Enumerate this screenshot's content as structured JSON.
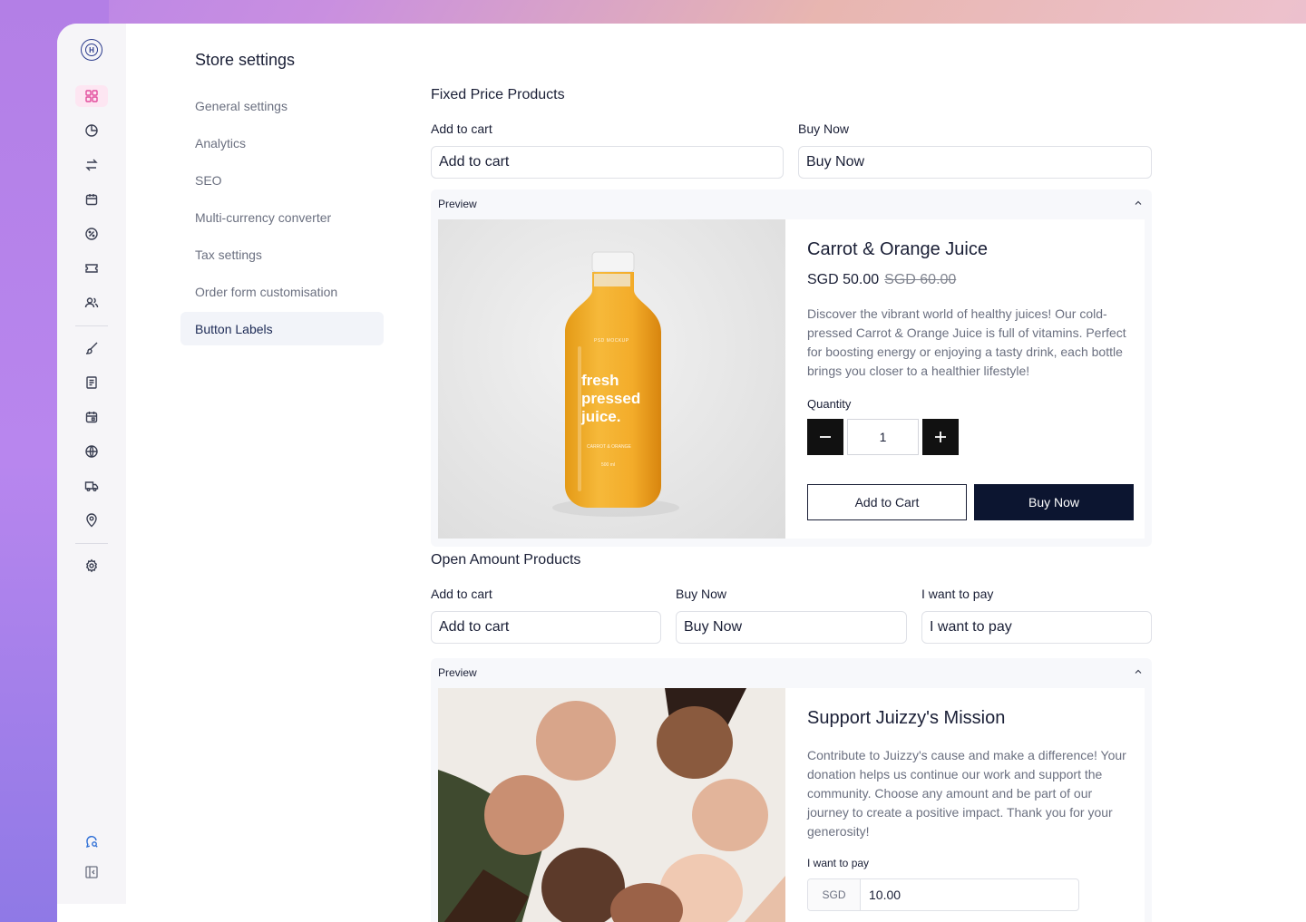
{
  "sidebar": {
    "logo_letter": "H",
    "icons": [
      "grid-icon",
      "clock-icon",
      "arrows-icon",
      "calendar-box-icon",
      "percent-icon",
      "ticket-icon",
      "users-icon",
      "brush-icon",
      "document-icon",
      "calendar-icon",
      "globe-icon",
      "truck-icon",
      "location-icon",
      "gear-icon",
      "support-icon",
      "collapse-icon"
    ]
  },
  "settings": {
    "title": "Store settings",
    "items": [
      {
        "label": "General settings"
      },
      {
        "label": "Analytics"
      },
      {
        "label": "SEO"
      },
      {
        "label": "Multi-currency converter"
      },
      {
        "label": "Tax settings"
      },
      {
        "label": "Order form customisation"
      },
      {
        "label": "Button Labels",
        "active": true
      }
    ]
  },
  "fixed": {
    "title": "Fixed Price Products",
    "add_label": "Add to cart",
    "add_value": "Add to cart",
    "buy_label": "Buy Now",
    "buy_value": "Buy Now",
    "preview_label": "Preview",
    "product": {
      "name": "Carrot & Orange Juice",
      "price": "SGD 50.00",
      "old_price": "SGD 60.00",
      "description": "Discover the vibrant world of healthy juices! Our cold-pressed Carrot & Orange Juice is full of vitamins. Perfect for boosting energy or enjoying a tasty drink, each bottle brings you closer to a healthier lifestyle!",
      "quantity_label": "Quantity",
      "quantity": "1",
      "add_button": "Add to Cart",
      "buy_button": "Buy Now",
      "bottle_small": "PSD MOCKUP",
      "bottle_big": [
        "fresh",
        "pressed",
        "juice."
      ],
      "bottle_flavor": "CARROT & ORANGE",
      "bottle_size": "500 ml"
    }
  },
  "open": {
    "title": "Open Amount Products",
    "add_label": "Add to cart",
    "add_value": "Add to cart",
    "buy_label": "Buy Now",
    "buy_value": "Buy Now",
    "pay_label": "I want to pay",
    "pay_value": "I want to pay",
    "preview_label": "Preview",
    "product": {
      "name": "Support Juizzy's Mission",
      "description": "Contribute to Juizzy's cause and make a difference! Your donation helps us continue our work and support the community. Choose any amount and be part of our journey to create a positive impact. Thank you for your generosity!",
      "pay_label": "I want to pay",
      "currency": "SGD",
      "amount": "10.00"
    }
  },
  "colors": {
    "accent": "#0c1530",
    "active_nav_bg": "#f2f4f9",
    "rail_active": "#e24c9c"
  }
}
